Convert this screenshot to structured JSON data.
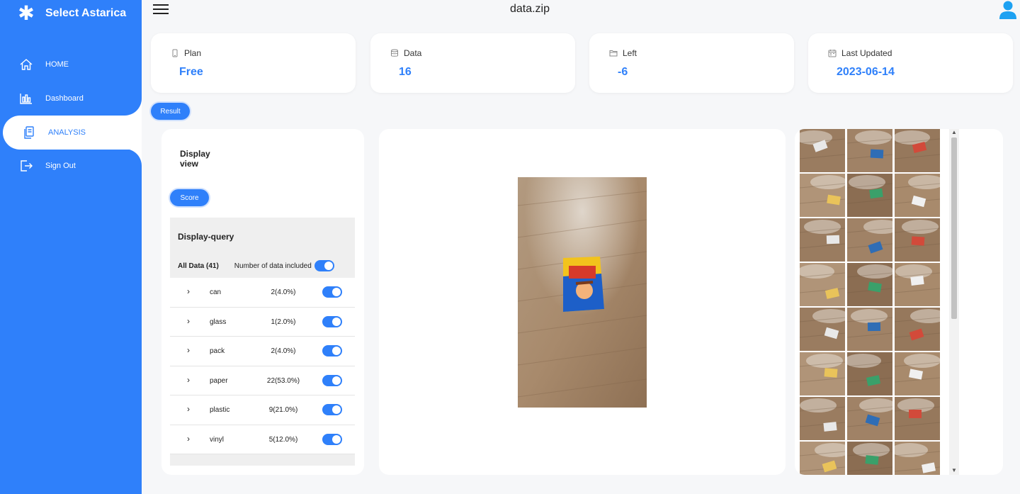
{
  "app": {
    "name": "Select Astarica"
  },
  "header": {
    "title": "data.zip"
  },
  "nav": [
    {
      "label": "HOME",
      "icon": "home-icon"
    },
    {
      "label": "Dashboard",
      "icon": "bar-chart-icon"
    },
    {
      "label": "ANALYSIS",
      "icon": "document-copy-icon",
      "active": true
    },
    {
      "label": "Sign Out",
      "icon": "sign-out-icon"
    }
  ],
  "stats": [
    {
      "label": "Plan",
      "value": "Free",
      "icon": "phone-icon"
    },
    {
      "label": "Data",
      "value": "16",
      "icon": "database-icon"
    },
    {
      "label": "Left",
      "value": "-6",
      "icon": "folder-icon"
    },
    {
      "label": "Last Updated",
      "value": "2023-06-14",
      "icon": "calendar-icon"
    }
  ],
  "buttons": {
    "result": "Result",
    "score": "Score"
  },
  "display_view": {
    "title": "Display view"
  },
  "query": {
    "title": "Display-query",
    "all_label": "All Data (41)",
    "included_label": "Number of data included",
    "included_enabled": true,
    "categories": [
      {
        "name": "can",
        "count": "2(4.0%)",
        "enabled": true
      },
      {
        "name": "glass",
        "count": "1(2.0%)",
        "enabled": true
      },
      {
        "name": "pack",
        "count": "2(4.0%)",
        "enabled": true
      },
      {
        "name": "paper",
        "count": "22(53.0%)",
        "enabled": true
      },
      {
        "name": "plastic",
        "count": "9(21.0%)",
        "enabled": true
      },
      {
        "name": "vinyl",
        "count": "5(12.0%)",
        "enabled": true
      }
    ]
  },
  "colors": {
    "accent": "#2f80fa",
    "floor": "#a88a6c"
  },
  "thumbnails_count": 24
}
